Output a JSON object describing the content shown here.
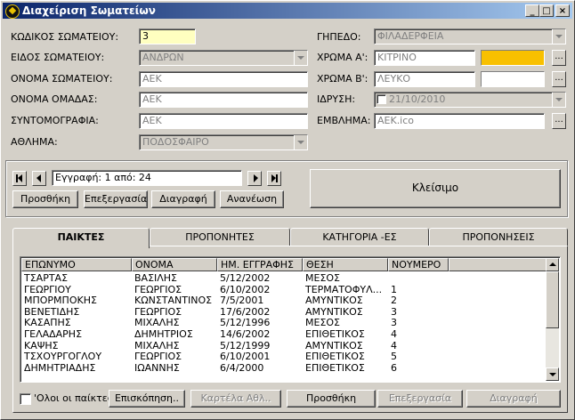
{
  "window": {
    "title": "Διαχείριση Σωματείων"
  },
  "form": {
    "code_label": "ΚΩΔΙΚΟΣ ΣΩΜΑΤΕΙΟΥ:",
    "code_value": "3",
    "type_label": "ΕΙΔΟΣ ΣΩΜΑΤΕΙΟΥ:",
    "type_value": "ΑΝΔΡΩΝ",
    "name_label": "ΟΝΟΜΑ ΣΩΜΑΤΕΙΟΥ:",
    "name_value": "ΑΕΚ",
    "team_label": "ΟΝΟΜΑ ΟΜΑΔΑΣ:",
    "team_value": "ΑΕΚ",
    "abbr_label": "ΣΥΝΤΟΜΟΓΡΑΦΙΑ:",
    "abbr_value": "ΑΕΚ",
    "sport_label": "ΑΘΛΗΜΑ:",
    "sport_value": "ΠΟΔΟΣΦΑΙΡΟ",
    "stadium_label": "ΓΗΠΕΔΟ:",
    "stadium_value": "ΦΙΛΑΔΕΡΦΕΙΑ",
    "color_a_label": "ΧΡΩΜΑ Α':",
    "color_a_value": "ΚΙΤΡΙΝΟ",
    "color_a_swatch": "#f8c000",
    "color_b_label": "ΧΡΩΜΑ Β':",
    "color_b_value": "ΛΕΥΚΟ",
    "color_b_swatch": "#ffffff",
    "founded_label": "ΙΔΡΥΣΗ:",
    "founded_value": "21/10/2010",
    "emblem_label": "ΕΜΒΛΗΜΑ:",
    "emblem_value": "AEK.ico",
    "dots": "..."
  },
  "navigator": {
    "record_text": "Εγγραφή: 1 από: 24",
    "add_label": "Προσθήκη",
    "edit_label": "Επεξεργασία",
    "delete_label": "Διαγραφή",
    "refresh_label": "Ανανέωση",
    "close_label": "Κλείσιμο"
  },
  "tabs": [
    "ΠΑΙΚΤΕΣ",
    "ΠΡΟΠΟΝΗΤΕΣ",
    "ΚΑΤΗΓΟΡΙΑ -ΕΣ",
    "ΠΡΟΠΟΝΗΣΕΙΣ"
  ],
  "grid": {
    "columns": [
      "ΕΠΩΝΥΜΟ",
      "ΟΝΟΜΑ",
      "ΗΜ. ΕΓΓΡΑΦΗΣ",
      "ΘΕΣΗ",
      "ΝΟΥΜΕΡΟ"
    ],
    "rows": [
      [
        "ΤΣΑΡΤΑΣ",
        "ΒΑΣΙΛΗΣ",
        "5/12/2002",
        "ΜΕΣΟΣ",
        ""
      ],
      [
        "ΓΕΩΡΓΙΟΥ",
        "ΓΕΩΡΓΙΟΣ",
        "6/10/2002",
        "ΤΕΡΜΑΤΟΦΥΛ...",
        "1"
      ],
      [
        "ΜΠΟΡΜΠΟΚΗΣ",
        "ΚΩΝΣΤΑΝΤΙΝΟΣ",
        "7/5/2001",
        "ΑΜΥΝΤΙΚΟΣ",
        "2"
      ],
      [
        "ΒΕΝΕΤΙΔΗΣ",
        "ΓΕΩΡΓΙΟΣ",
        "17/6/2002",
        "ΑΜΥΝΤΙΚΟΣ",
        "3"
      ],
      [
        "ΚΑΣΑΠΗΣ",
        "ΜΙΧΑΛΗΣ",
        "5/12/1996",
        "ΜΕΣΟΣ",
        "3"
      ],
      [
        "ΓΕΛΑΔΑΡΗΣ",
        "ΔΗΜΗΤΡΙΟΣ",
        "14/6/2002",
        "ΕΠΙΘΕΤΙΚΟΣ",
        "4"
      ],
      [
        "ΚΑΨΗΣ",
        "ΜΙΧΑΛΗΣ",
        "5/12/1999",
        "ΑΜΥΝΤΙΚΟΣ",
        "4"
      ],
      [
        "ΤΣΧΟΥΡΓΟΓΛΟΥ",
        "ΓΕΩΡΓΙΟΣ",
        "6/10/2001",
        "ΕΠΙΘΕΤΙΚΟΣ",
        "5"
      ],
      [
        "ΔΗΜΗΤΡΙΑΔΗΣ",
        "ΙΩΑΝΝΗΣ",
        "6/4/2000",
        "ΕΠΙΘΕΤΙΚΟΣ",
        "6"
      ]
    ]
  },
  "bottom": {
    "all_players_label": "'Ολοι οι παίκτες",
    "preview_label": "Επισκόπηση..",
    "card_label": "Καρτέλα Αθλ..",
    "add_label": "Προσθήκη",
    "edit_label": "Επεξεργασία",
    "delete_label": "Διαγραφή"
  }
}
